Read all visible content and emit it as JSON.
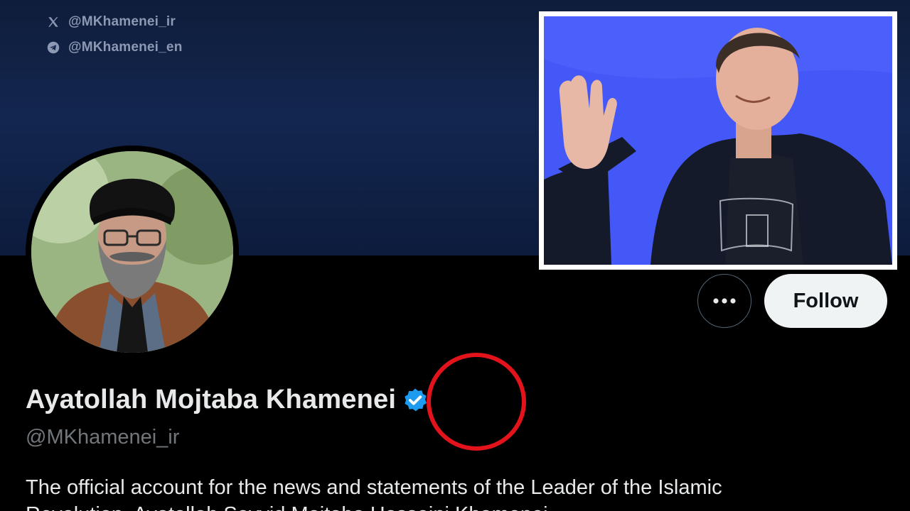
{
  "banner": {
    "x_handle": "@MKhamenei_ir",
    "telegram_handle": "@MKhamenei_en"
  },
  "profile": {
    "display_name": "Ayatollah Mojtaba Khamenei",
    "handle": "@MKhamenei_ir",
    "bio_line1": "The official account for the news and statements of the Leader of the Islamic",
    "bio_line2": "Revolution, Ayatollah Seyyid Mojtaba Hosseini Khamenei.",
    "verified_badge_color": "#1d9bf0"
  },
  "actions": {
    "follow_label": "Follow",
    "more_icon": "ellipsis-icon"
  },
  "colors": {
    "background": "#000000",
    "banner": "#13264f",
    "follow_button_bg": "#eff3f4",
    "highlight_ring": "#e3131b",
    "inset_background": "#3f55f5"
  }
}
